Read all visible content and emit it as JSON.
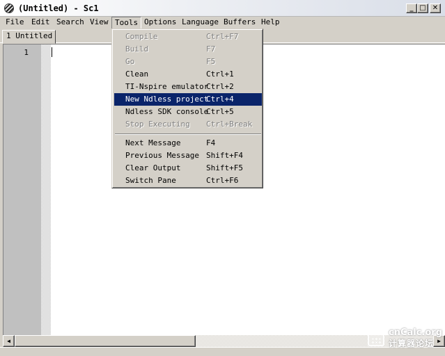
{
  "window": {
    "title": "(Untitled) - Sc1",
    "minimize_glyph": "_",
    "maximize_glyph": "□",
    "close_glyph": "✕"
  },
  "menubar": {
    "items": [
      "File",
      "Edit",
      "Search",
      "View",
      "Tools",
      "Options",
      "Language",
      "Buffers",
      "Help"
    ],
    "open_menu": "Tools"
  },
  "tabs": [
    {
      "label": "1 Untitled",
      "active": true
    }
  ],
  "editor": {
    "line_numbers": [
      "1"
    ],
    "content": ""
  },
  "tools_menu": {
    "items": [
      {
        "label": "Compile",
        "shortcut": "Ctrl+F7",
        "enabled": false
      },
      {
        "label": "Build",
        "shortcut": "F7",
        "enabled": false
      },
      {
        "label": "Go",
        "shortcut": "F5",
        "enabled": false
      },
      {
        "label": "Clean",
        "shortcut": "Ctrl+1",
        "enabled": true
      },
      {
        "label": "TI-Nspire emulator",
        "shortcut": "Ctrl+2",
        "enabled": true
      },
      {
        "label": "New Ndless project",
        "shortcut": "Ctrl+4",
        "enabled": true,
        "highlighted": true
      },
      {
        "label": "Ndless SDK console",
        "shortcut": "Ctrl+5",
        "enabled": true
      },
      {
        "label": "Stop Executing",
        "shortcut": "Ctrl+Break",
        "enabled": false
      },
      {
        "label": "Next Message",
        "shortcut": "F4",
        "enabled": true
      },
      {
        "label": "Previous Message",
        "shortcut": "Shift+F4",
        "enabled": true
      },
      {
        "label": "Clear Output",
        "shortcut": "Shift+F5",
        "enabled": true
      },
      {
        "label": "Switch Pane",
        "shortcut": "Ctrl+F6",
        "enabled": true
      }
    ]
  },
  "scrollbar": {
    "left_arrow": "◀",
    "right_arrow": "▶"
  },
  "watermark": {
    "top": "cnCalc.org",
    "bottom": "计算器论坛"
  },
  "colors": {
    "chrome": "#d4d0c8",
    "highlight": "#0a246a",
    "gutter": "#c0c0c0",
    "disabled_text": "#808080"
  }
}
